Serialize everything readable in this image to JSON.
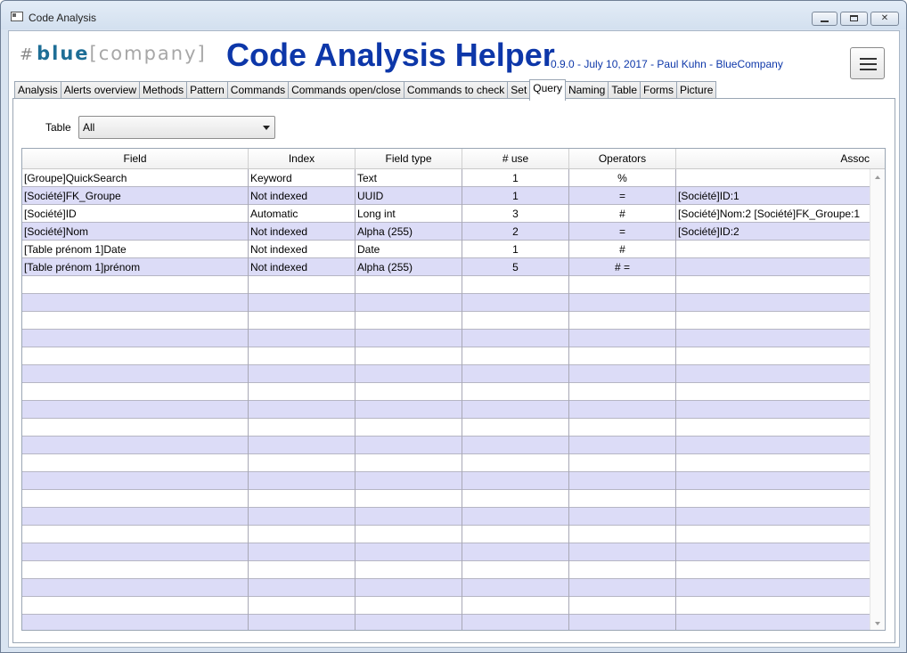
{
  "window": {
    "title": "Code Analysis"
  },
  "header": {
    "logo_hash": "#",
    "logo_blue": "blue",
    "logo_rest": "[company]",
    "title": "Code Analysis Helper",
    "version": "0.9.0 - July 10, 2017 - Paul Kuhn - BlueCompany"
  },
  "tabs": [
    {
      "label": "Analysis"
    },
    {
      "label": "Alerts overview"
    },
    {
      "label": "Methods"
    },
    {
      "label": "Pattern"
    },
    {
      "label": "Commands"
    },
    {
      "label": "Commands open/close"
    },
    {
      "label": "Commands to check"
    },
    {
      "label": "Set"
    },
    {
      "label": "Query",
      "active": true
    },
    {
      "label": "Naming"
    },
    {
      "label": "Table"
    },
    {
      "label": "Forms"
    },
    {
      "label": "Picture"
    }
  ],
  "filter": {
    "label": "Table",
    "selected": "All"
  },
  "grid": {
    "columns": [
      "Field",
      "Index",
      "Field type",
      "# use",
      "Operators",
      "Assoc"
    ],
    "rows": [
      [
        "[Groupe]QuickSearch",
        "Keyword",
        "Text",
        "1",
        "%",
        ""
      ],
      [
        "[Société]FK_Groupe",
        "Not indexed",
        "UUID",
        "1",
        "=",
        "[Société]ID:1"
      ],
      [
        "[Société]ID",
        "Automatic",
        "Long int",
        "3",
        "#",
        "[Société]Nom:2 [Société]FK_Groupe:1"
      ],
      [
        "[Société]Nom",
        "Not indexed",
        "Alpha (255)",
        "2",
        "=",
        "[Société]ID:2"
      ],
      [
        "[Table prénom 1]Date",
        "Not indexed",
        "Date",
        "1",
        "#",
        ""
      ],
      [
        "[Table prénom 1]prénom",
        "Not indexed",
        "Alpha (255)",
        "5",
        "# =",
        ""
      ]
    ]
  }
}
